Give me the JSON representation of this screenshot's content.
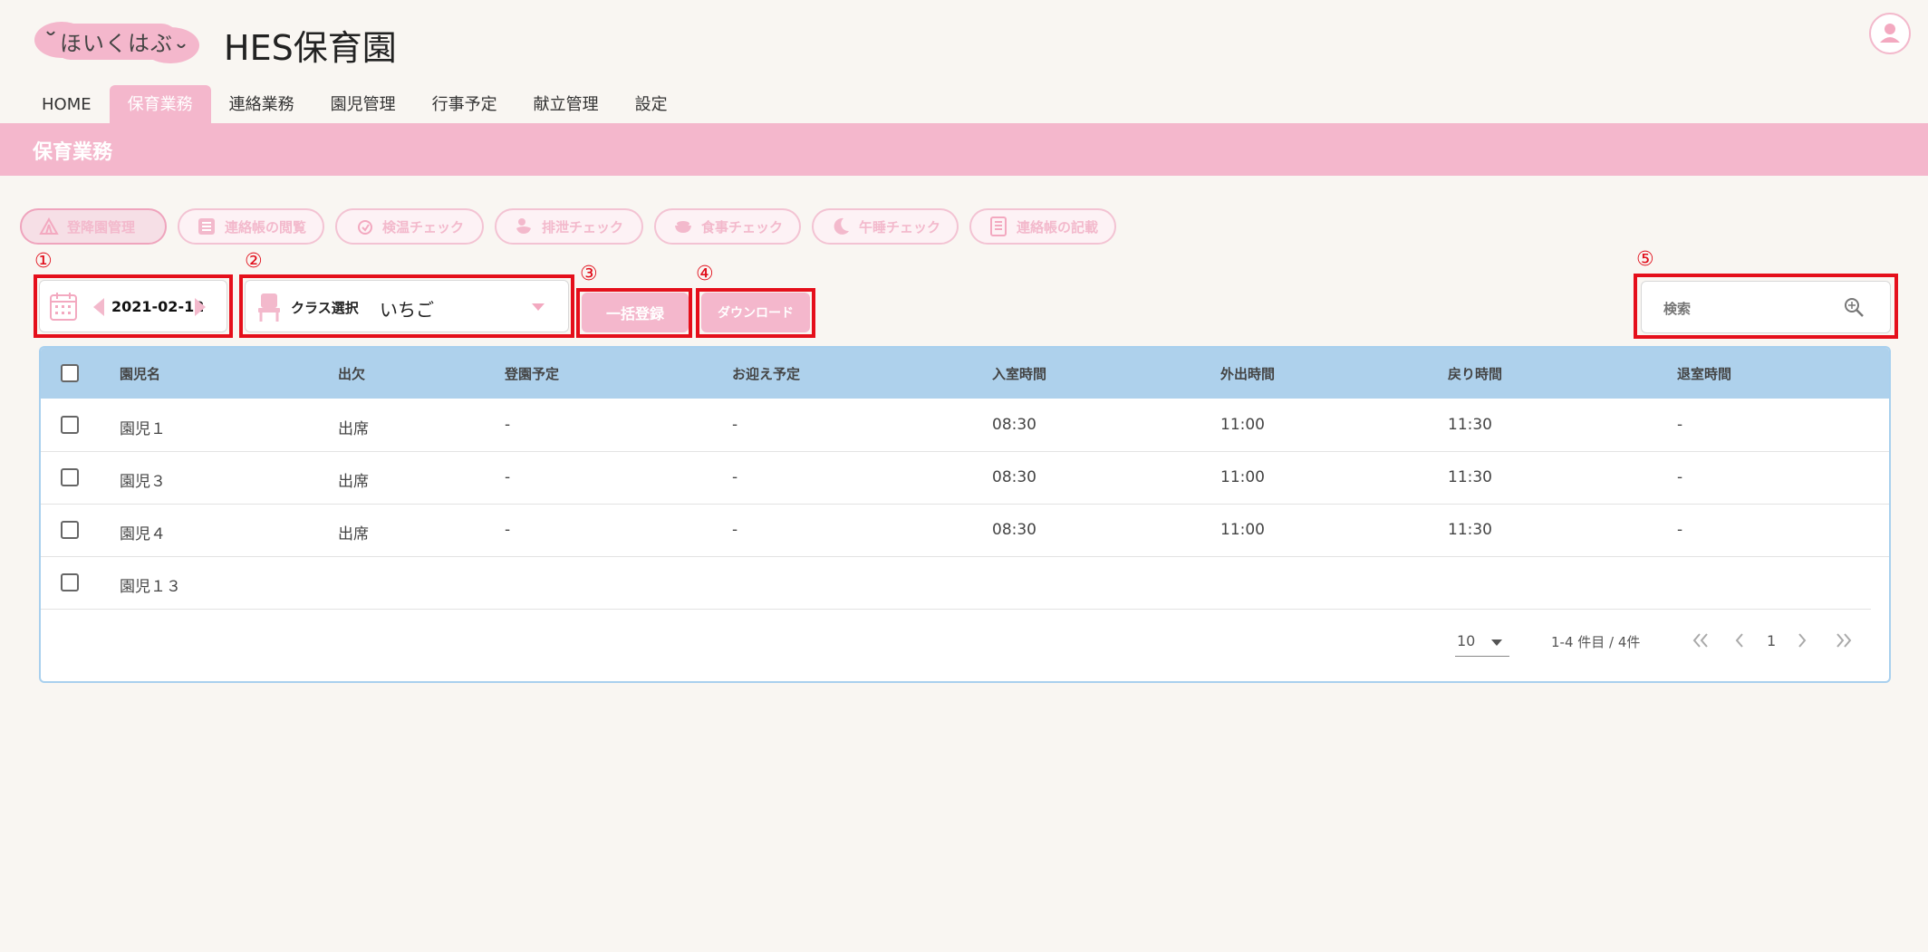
{
  "header": {
    "logo_text": "ほいくはぶ",
    "title": "HES保育園"
  },
  "nav": {
    "items": [
      "HOME",
      "保育業務",
      "連絡業務",
      "園児管理",
      "行事予定",
      "献立管理",
      "設定"
    ],
    "active": "保育業務"
  },
  "banner": {
    "title": "保育業務"
  },
  "functions": [
    {
      "label": "登降園管理",
      "icon": "tent-icon"
    },
    {
      "label": "連絡帳の閲覧",
      "icon": "list-icon"
    },
    {
      "label": "検温チェック",
      "icon": "thermometer-icon"
    },
    {
      "label": "排泄チェック",
      "icon": "duck-icon"
    },
    {
      "label": "食事チェック",
      "icon": "bowl-icon"
    },
    {
      "label": "午睡チェック",
      "icon": "moon-icon"
    },
    {
      "label": "連絡帳の記載",
      "icon": "notebook-icon"
    }
  ],
  "annotations": [
    "①",
    "②",
    "③",
    "④",
    "⑤"
  ],
  "date_picker": {
    "value": "2021-02-12"
  },
  "class_select": {
    "label": "クラス選択",
    "value": "いちご"
  },
  "buttons": {
    "bulk_register": "一括登録",
    "download": "ダウンロード"
  },
  "search": {
    "placeholder": "検索"
  },
  "table": {
    "columns": [
      "園児名",
      "出欠",
      "登園予定",
      "お迎え予定",
      "入室時間",
      "外出時間",
      "戻り時間",
      "退室時間"
    ],
    "rows": [
      [
        "園児１",
        "出席",
        "-",
        "-",
        "08:30",
        "11:00",
        "11:30",
        "-"
      ],
      [
        "園児３",
        "出席",
        "-",
        "-",
        "08:30",
        "11:00",
        "11:30",
        "-"
      ],
      [
        "園児４",
        "出席",
        "-",
        "-",
        "08:30",
        "11:00",
        "11:30",
        "-"
      ],
      [
        "園児１３",
        "",
        "",
        "",
        "",
        "",
        "",
        ""
      ]
    ]
  },
  "pagination": {
    "per_page": "10",
    "range": "1-4 件目 / 4件",
    "page": "1"
  },
  "colors": {
    "pink": "#f4b7cc",
    "header_blue": "#aed1ec",
    "annotation_red": "#e50f1b"
  }
}
